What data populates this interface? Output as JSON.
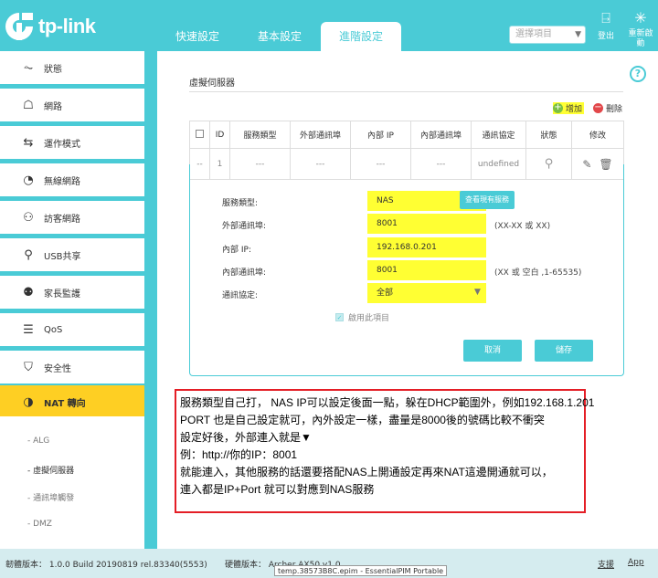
{
  "header": {
    "brand": "tp-link",
    "tabs": [
      {
        "label": "快速設定"
      },
      {
        "label": "基本設定"
      },
      {
        "label": "進階設定"
      }
    ],
    "language_select": {
      "value": "選擇項目"
    },
    "logout_label": "登出",
    "reboot_label": "重新啟動"
  },
  "sidebar": {
    "items": [
      {
        "label": "狀態",
        "icon": "pulse-icon"
      },
      {
        "label": "網路",
        "icon": "network-icon"
      },
      {
        "label": "運作模式",
        "icon": "switch-mode-icon"
      },
      {
        "label": "無線網路",
        "icon": "wifi-icon"
      },
      {
        "label": "訪客網路",
        "icon": "guest-icon"
      },
      {
        "label": "USB共享",
        "icon": "usb-icon"
      },
      {
        "label": "家長監護",
        "icon": "parental-icon"
      },
      {
        "label": "QoS",
        "icon": "qos-icon"
      },
      {
        "label": "安全性",
        "icon": "shield-icon"
      },
      {
        "label": "NAT 轉向",
        "icon": "nat-icon"
      }
    ],
    "submenu": [
      {
        "label": "ALG"
      },
      {
        "label": "虛擬伺服器"
      },
      {
        "label": "通訊埠觸發"
      },
      {
        "label": "DMZ"
      }
    ]
  },
  "main": {
    "title": "虛擬伺服器",
    "add_label": "增加",
    "delete_label": "刪除",
    "table": {
      "headers": [
        "ID",
        "服務類型",
        "外部通訊埠",
        "內部 IP",
        "內部通訊埠",
        "通訊協定",
        "狀態",
        "修改"
      ],
      "row": {
        "check": "--",
        "id": "1",
        "service": "---",
        "ext_port": "---",
        "int_ip": "---",
        "int_port": "---",
        "protocol": "undefined"
      }
    },
    "form": {
      "service_type_label": "服務類型:",
      "service_type_value": "NAS",
      "view_services_label": "查看現有服務",
      "ext_port_label": "外部通訊埠:",
      "ext_port_value": "8001",
      "ext_port_hint": "(XX-XX 或 XX)",
      "int_ip_label": "內部 IP:",
      "int_ip_value": "192.168.0.201",
      "int_port_label": "內部通訊埠:",
      "int_port_value": "8001",
      "int_port_hint": "(XX 或 空白 ,1-65535)",
      "protocol_label": "通訊協定:",
      "protocol_value": "全部",
      "enable_label": "啟用此項目",
      "cancel_label": "取消",
      "save_label": "儲存"
    },
    "annotation_lines": [
      "服務類型自己打， NAS IP可以設定後面一點，躲在DHCP範圍外，例如192.168.1.201",
      "PORT 也是自己設定就可，內外設定一樣，盡量是8000後的號碼比較不衝突",
      "設定好後，外部連入就是▼",
      "例：http://你的IP：8001",
      "就能連入，其他服務的話還要搭配NAS上開通設定再來NAT這邊開通就可以，",
      "連入都是IP+Port 就可以對應到NAS服務"
    ]
  },
  "footer": {
    "firmware": "韌體版本： 1.0.0 Build 20190819 rel.83340(5553)",
    "hardware": "硬體版本： Archer AX50 v1.0",
    "tooltip": "temp.38573B8C.epim - EssentialPIM Portable",
    "support_label": "支援",
    "app_label": "App"
  },
  "colors": {
    "accent": "#4acbd6",
    "active": "#fecf23",
    "highlight": "#ffff33",
    "annotation_border": "#e41e26"
  }
}
